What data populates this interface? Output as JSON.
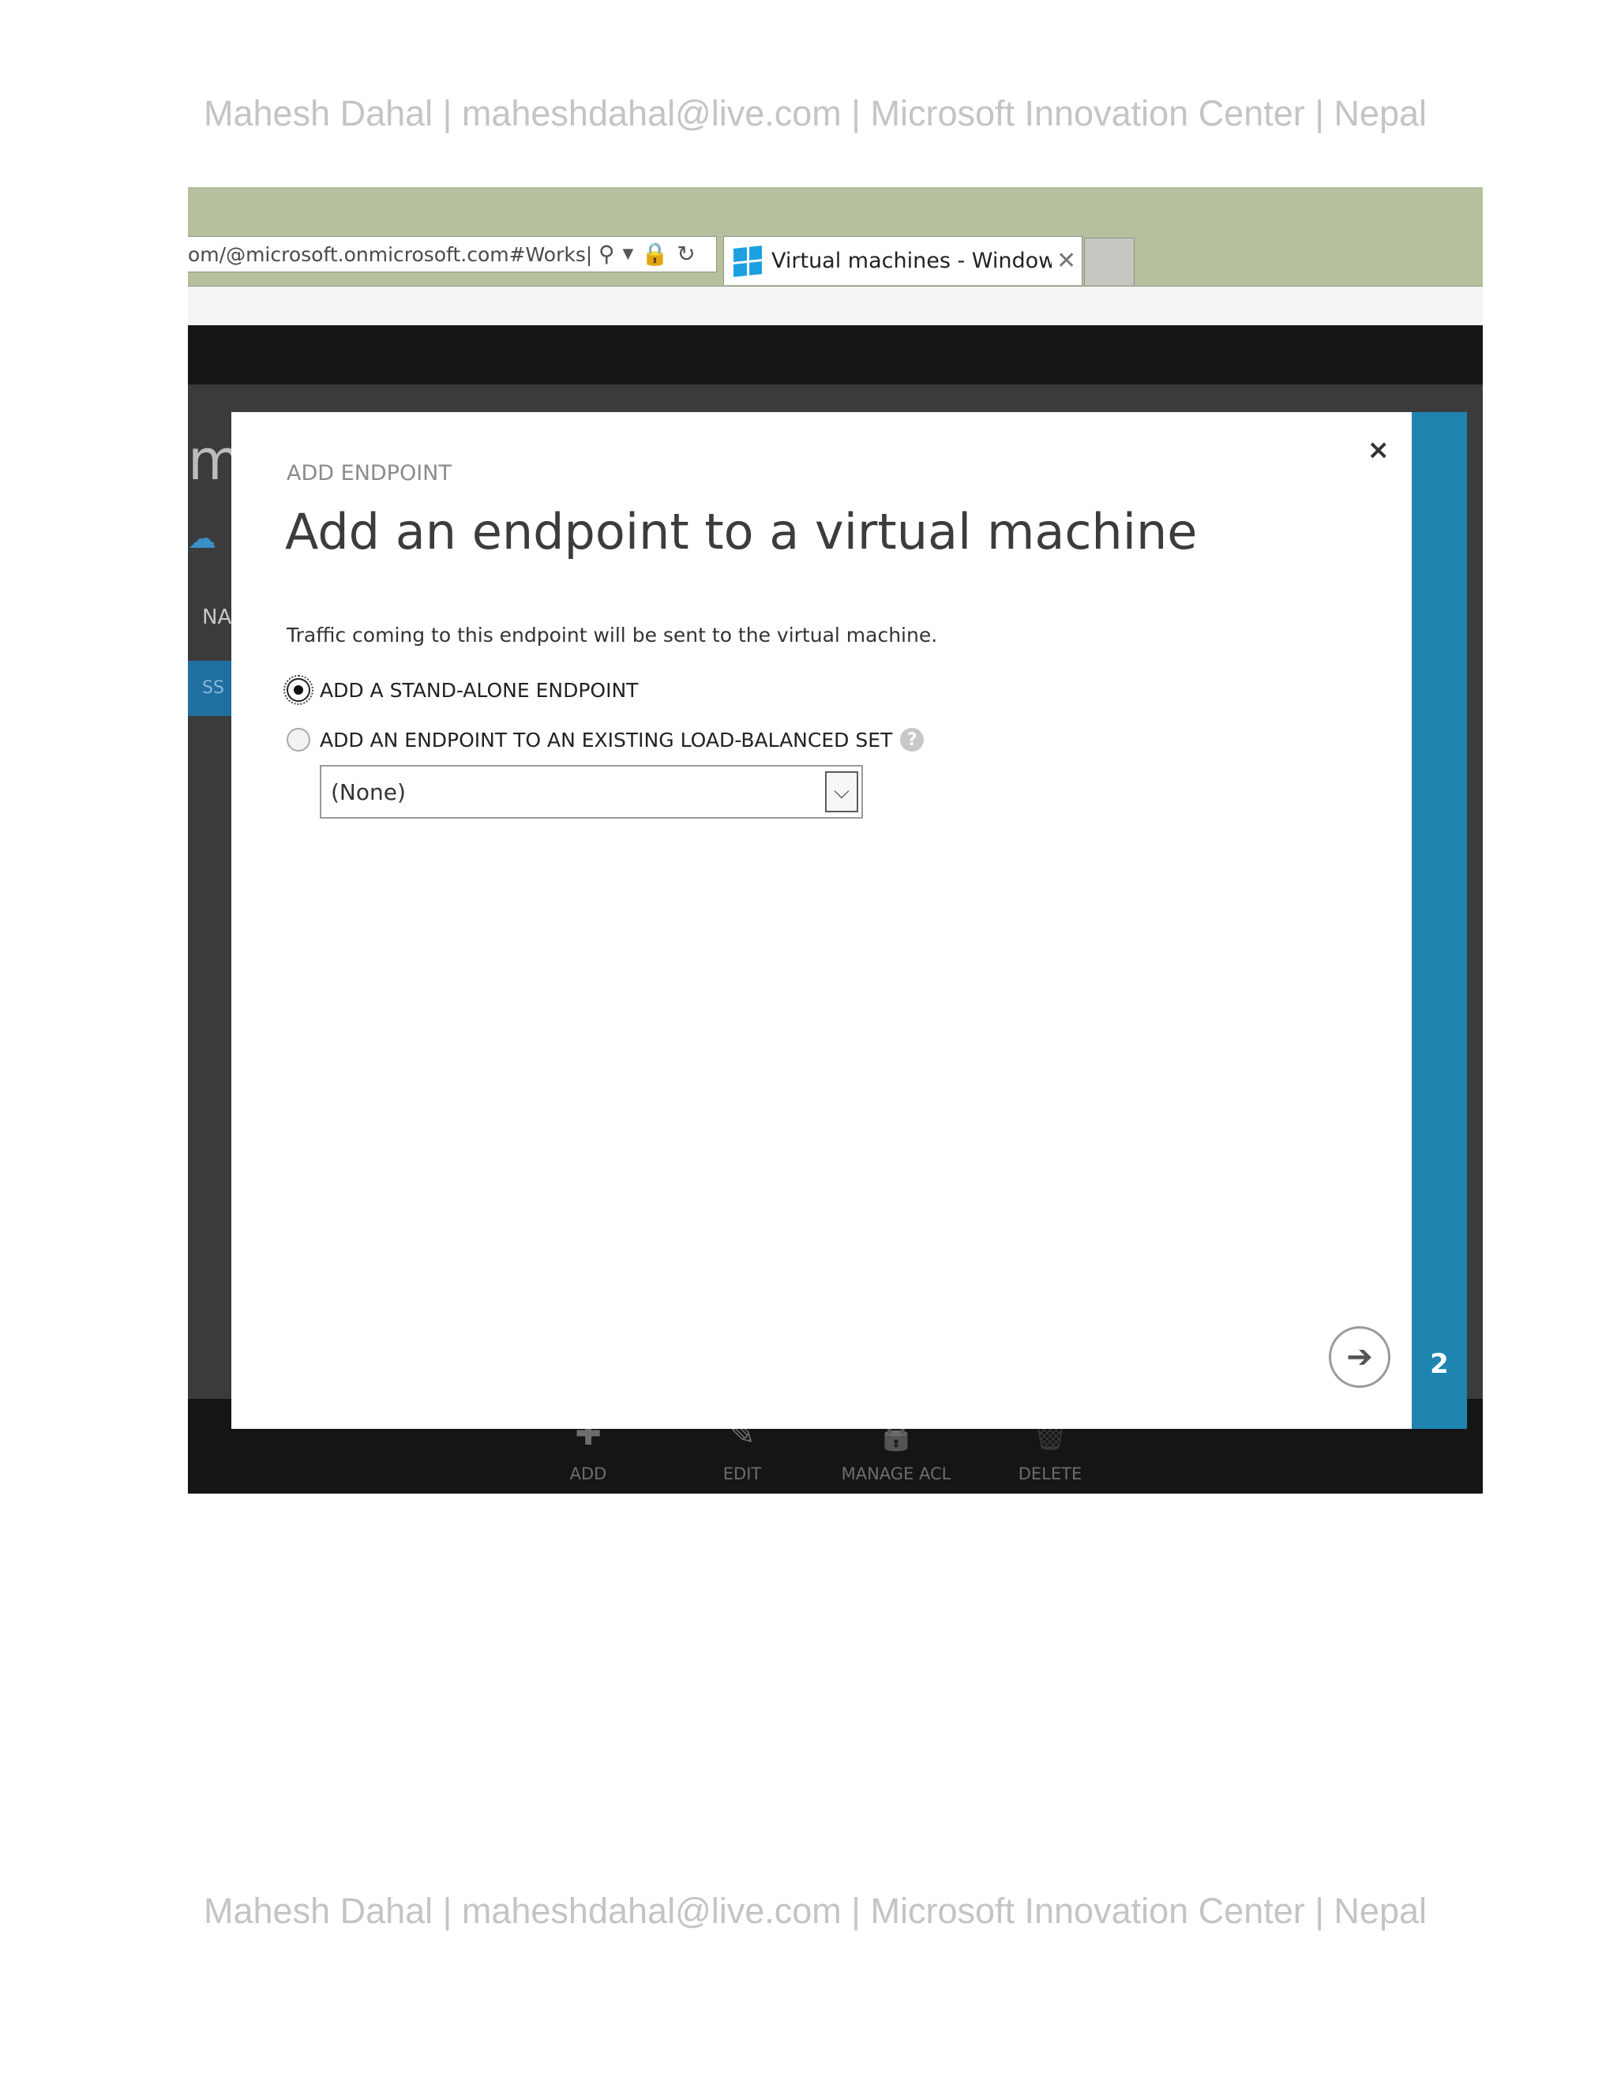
{
  "page": {
    "header_text": "Mahesh Dahal | maheshdahal@live.com | Microsoft Innovation Center | Nepal",
    "footer_text": "Mahesh Dahal | maheshdahal@live.com | Microsoft Innovation Center | Nepal"
  },
  "browser": {
    "address_text": "om/@microsoft.onmicrosoft.com#Works|",
    "tab_title": "Virtual machines - Window...",
    "tab_close": "✕"
  },
  "background": {
    "edge_m": "mi",
    "edge_na": "NA",
    "edge_ss": "SS"
  },
  "command_bar": {
    "items": [
      {
        "label": "ADD",
        "icon": "✚"
      },
      {
        "label": "EDIT",
        "icon": "✎"
      },
      {
        "label": "MANAGE ACL",
        "icon": "🔒"
      },
      {
        "label": "DELETE",
        "icon": "🗑"
      }
    ]
  },
  "dialog": {
    "kicker": "ADD ENDPOINT",
    "title": "Add an endpoint to a virtual machine",
    "description": "Traffic coming to this endpoint will be sent to the virtual machine.",
    "options": [
      {
        "label": "ADD A STAND-ALONE ENDPOINT",
        "checked": true
      },
      {
        "label": "ADD AN ENDPOINT TO AN EXISTING LOAD-BALANCED SET",
        "checked": false
      }
    ],
    "help_glyph": "?",
    "select_value": "(None)",
    "close_glyph": "×",
    "next_glyph": "➔",
    "step_number": "2"
  },
  "colors": {
    "accent": "#1f84b0",
    "browser_chrome": "#b5c19e",
    "portal_dark": "#151515"
  }
}
